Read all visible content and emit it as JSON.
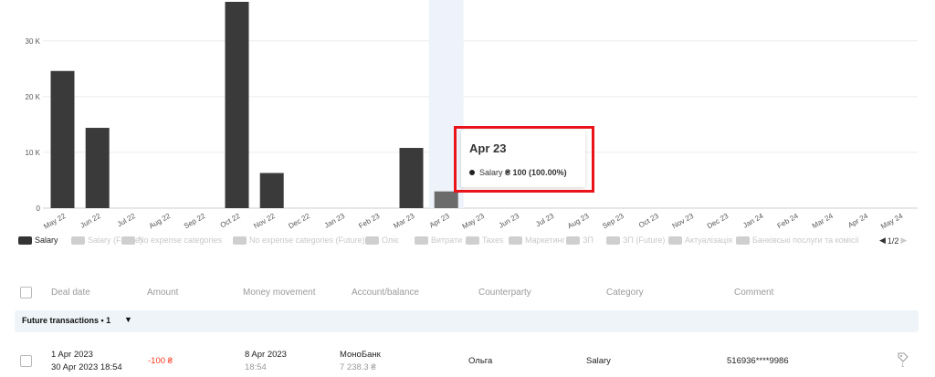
{
  "chart_data": {
    "type": "bar",
    "categories": [
      "May 22",
      "Jun 22",
      "Jul 22",
      "Aug 22",
      "Sep 22",
      "Oct 22",
      "Nov 22",
      "Dec 22",
      "Jan 23",
      "Feb 23",
      "Mar 23",
      "Apr 23",
      "May 23",
      "Jun 23",
      "Jul 23",
      "Aug 23",
      "Sep 23",
      "Oct 23",
      "Nov 23",
      "Dec 23",
      "Jan 24",
      "Feb 24",
      "Mar 24",
      "Apr 24",
      "May 24"
    ],
    "series": [
      {
        "name": "Salary",
        "values": [
          24600,
          14400,
          0,
          0,
          0,
          37000,
          6300,
          0,
          0,
          0,
          10800,
          3000,
          0,
          0,
          0,
          0,
          0,
          0,
          0,
          0,
          0,
          0,
          0,
          0,
          0
        ]
      }
    ],
    "yticks": [
      "0",
      "10 K",
      "20 K",
      "30 K"
    ],
    "ylim": [
      0,
      37000
    ],
    "highlighted_category": "Apr 23",
    "grid": true,
    "colors": {
      "bar": "#3a3a3a",
      "bar_highlight": "#6b6b6b",
      "hover_band": "#eef3fb"
    }
  },
  "tooltip": {
    "title": "Apr 23",
    "series_label": "Salary",
    "value_text": "₴ 100 (100.00%)"
  },
  "legend": {
    "items": [
      {
        "label": "Salary",
        "active": true,
        "color": "#333333"
      },
      {
        "label": "Salary (Future)",
        "active": false,
        "color": "#cfcfcf"
      },
      {
        "label": "No expense categories",
        "active": false,
        "color": "#cfcfcf"
      },
      {
        "label": "No expense categories (Future)",
        "active": false,
        "color": "#cfcfcf"
      },
      {
        "label": "Оліє",
        "active": false,
        "color": "#cfcfcf"
      },
      {
        "label": "Витрати",
        "active": false,
        "color": "#cfcfcf"
      },
      {
        "label": "Taxes",
        "active": false,
        "color": "#cfcfcf"
      },
      {
        "label": "Маркетинг",
        "active": false,
        "color": "#cfcfcf"
      },
      {
        "label": "ЗП",
        "active": false,
        "color": "#cfcfcf"
      },
      {
        "label": "ЗП (Future)",
        "active": false,
        "color": "#cfcfcf"
      },
      {
        "label": "Актуалізація",
        "active": false,
        "color": "#cfcfcf"
      },
      {
        "label": "Банківські послуги та комісії",
        "active": false,
        "color": "#cfcfcf"
      }
    ],
    "page": "1/2"
  },
  "table": {
    "headers": {
      "deal_date": "Deal date",
      "amount": "Amount",
      "money_movement": "Money movement",
      "account": "Account/balance",
      "counterparty": "Counterparty",
      "category": "Category",
      "comment": "Comment"
    },
    "group_label": "Future transactions • 1",
    "row": {
      "deal_date": "1 Apr 2023",
      "deal_datetime": "30 Apr 2023 18:54",
      "amount": "-100 ₴",
      "movement_date": "8 Apr 2023",
      "movement_time": "18:54",
      "account": "МоноБанк",
      "balance": "7 238.3 ₴",
      "counterparty": "Ольга",
      "category": "Salary",
      "comment": "516936****9986",
      "tag_count": "1"
    }
  }
}
